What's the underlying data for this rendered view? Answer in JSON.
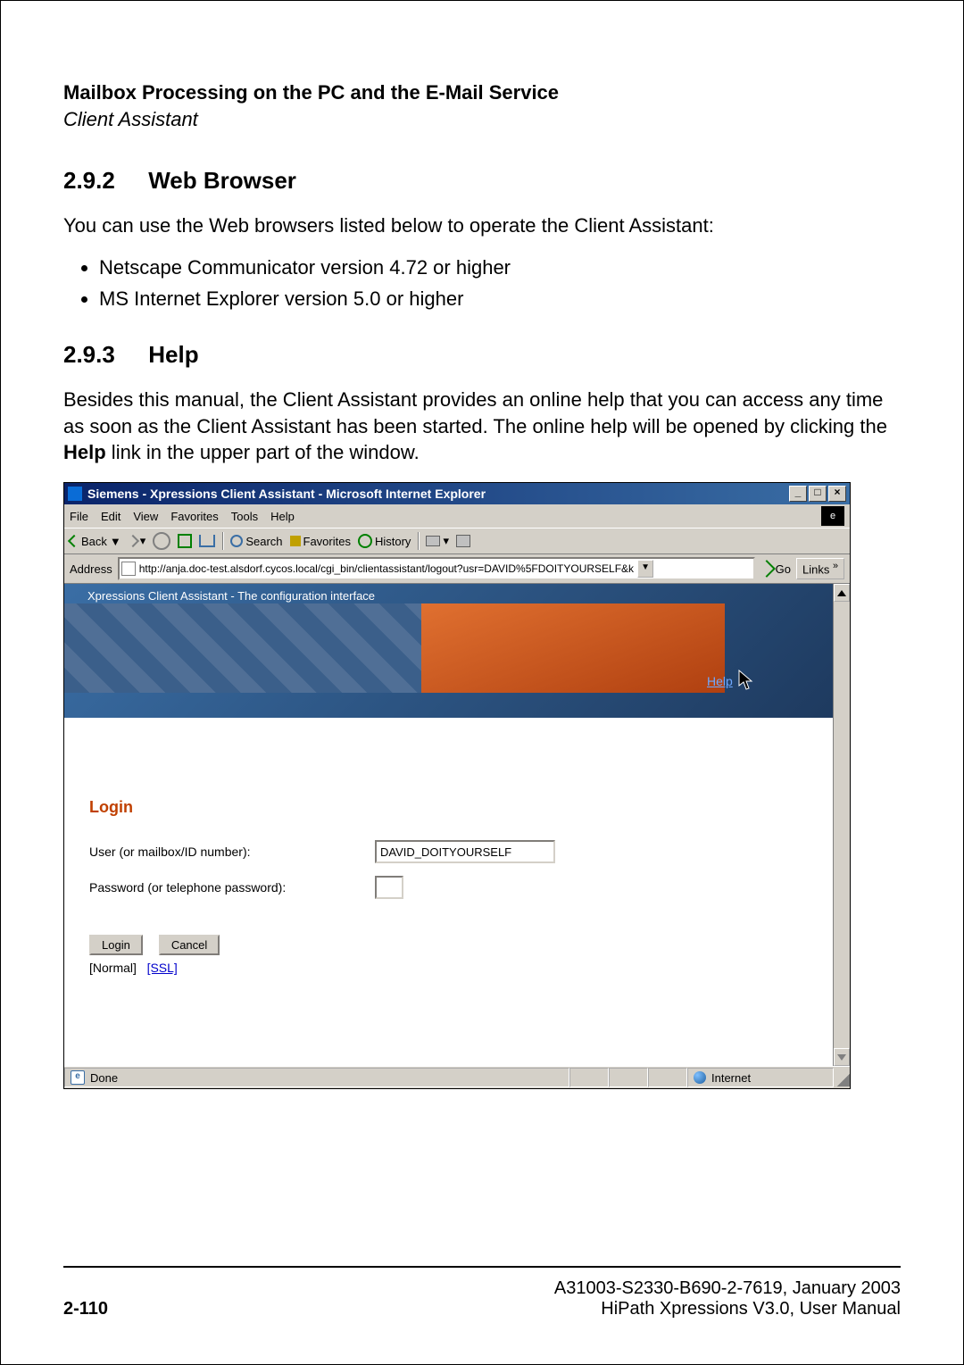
{
  "header": {
    "title": "Mailbox Processing on the PC and the E-Mail Service",
    "subtitle": "Client Assistant"
  },
  "sections": {
    "s1": {
      "num": "2.9.2",
      "title": "Web Browser"
    },
    "s2": {
      "num": "2.9.3",
      "title": "Help"
    }
  },
  "text": {
    "browsers_intro": "You can use the Web browsers listed below to operate the Client Assistant:",
    "bullet1": "Netscape Communicator version 4.72 or higher",
    "bullet2": "MS Internet Explorer version 5.0 or higher",
    "help_p_a": "Besides this manual, the Client Assistant provides an online help that you can access any time as soon as the Client Assistant has been started. The online help will be opened by clicking the ",
    "help_p_b": "Help",
    "help_p_c": " link in the upper part of the window."
  },
  "ie": {
    "title": "Siemens - Xpressions Client Assistant - Microsoft Internet Explorer",
    "menus": {
      "file": "File",
      "edit": "Edit",
      "view": "View",
      "favorites": "Favorites",
      "tools": "Tools",
      "help": "Help"
    },
    "toolbar": {
      "back": "Back",
      "search": "Search",
      "favorites": "Favorites",
      "history": "History"
    },
    "address_label": "Address",
    "address_value": "http://anja.doc-test.alsdorf.cycos.local/cgi_bin/clientassistant/logout?usr=DAVID%5FDOITYOURSELF&k",
    "go": "Go",
    "links": "Links",
    "banner_caption": "Xpressions Client Assistant - The configuration interface",
    "help_link": "Help",
    "login": {
      "title": "Login",
      "user_label": "User (or mailbox/ID number):",
      "user_value": "DAVID_DOITYOURSELF",
      "pass_label": "Password (or telephone password):",
      "pass_value": "",
      "login_btn": "Login",
      "cancel_btn": "Cancel",
      "mode_normal": "[Normal]",
      "mode_ssl": "[SSL]"
    },
    "status": {
      "done": "Done",
      "zone": "Internet"
    }
  },
  "footer": {
    "page": "2-110",
    "line1": "A31003-S2330-B690-2-7619, January 2003",
    "line2": "HiPath Xpressions V3.0, User Manual"
  }
}
